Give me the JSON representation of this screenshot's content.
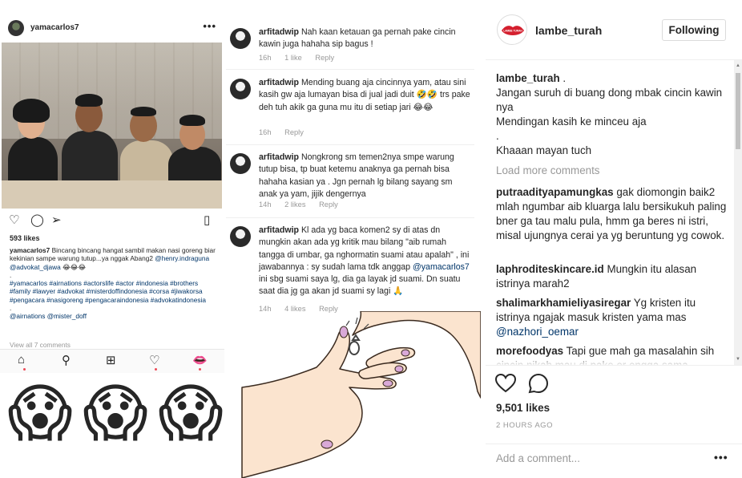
{
  "left_post": {
    "username": "yamacarlos7",
    "more": "•••",
    "likes": "593 likes",
    "caption_user": "yamacarlos7",
    "caption_text": "Bincang bincang hangat sambil makan nasi goreng biar kekinian sampe warung tutup...ya nggak Abang2",
    "caption_mentions": "@henry.indraguna @advokat_djawa",
    "caption_emoji": "😂😂😂",
    "dot1": ".",
    "hashtags": "#yamacarlos #airnations #actorslife #actor #indonesia #brothers #family #lawyer #advokat #misterdoffindonesia #corsa #jiwakorsa #pengacara #nasigoreng #pengacaraindonesia #advokatindonesia",
    "dot2": ".",
    "mentions2": "@airnations @mister_doff",
    "view_all": "View all 7 comments",
    "emojis": [
      "😱",
      "😱",
      "😱"
    ]
  },
  "middle_comments": [
    {
      "user": "arfitadwip",
      "text": "Nah kaan ketauan ga pernah pake cincin kawin juga hahaha sip bagus !",
      "time": "16h",
      "likes": "1 like",
      "reply": "Reply"
    },
    {
      "user": "arfitadwip",
      "text": "Mending buang aja cincinnya yam, atau sini kasih gw aja lumayan bisa di jual jadi duit 🤣🤣 trs pake deh tuh akik ga guna mu itu di setiap jari 😂😂",
      "time": "16h",
      "likes": "",
      "reply": "Reply"
    },
    {
      "user": "arfitadwip",
      "text": "Nongkrong sm temen2nya smpe warung tutup bisa, tp buat ketemu anaknya ga pernah bisa hahaha kasian ya . Jgn pernah lg bilang sayang sm anak ya yam, jijik dengernya",
      "time": "14h",
      "likes": "2 likes",
      "reply": "Reply"
    },
    {
      "user": "arfitadwip",
      "text_pre": "Kl ada yg baca komen2 sy di atas dn mungkin akan ada yg kritik mau bilang \"aib rumah tangga di umbar, ga nghormatin suami atau apalah\" ,  ini jawabannya : sy sudah lama tdk anggap ",
      "mention": "@yamacarlos7",
      "text_post": " ini sbg suami saya lg, dia ga layak jd suami. Dn suatu saat dia jg ga akan jd suami sy lagi 🙏",
      "time": "14h",
      "likes": "4 likes",
      "reply": "Reply"
    }
  ],
  "right_panel": {
    "account": "lambe_turah",
    "logo_text": "LAMBE TURAH",
    "follow_label": "Following",
    "caption_user": "lambe_turah",
    "caption_line0": ".",
    "caption_line1": "Jangan suruh di buang dong mbak cincin kawin nya",
    "caption_line2": "Mendingan kasih ke minceu aja",
    "caption_line3": ".",
    "caption_line4": "Khaaan mayan tuch",
    "load_more": "Load more comments",
    "comments": [
      {
        "user": "putraadityapamungkas",
        "text": "gak diomongin baik2 mlah ngumbar aib kluarga lalu bersikukuh paling bner ga tau malu pula, hmm ga beres ni istri, misal ujungnya cerai ya yg beruntung yg cowok."
      },
      {
        "user": "laphroditeskincare.id",
        "text": "Mungkin itu alasan istrinya marah2"
      },
      {
        "user": "shalimarkhamieliyasiregar",
        "text": "Yg kristen itu istrinya ngajak masuk kristen yama mas",
        "mention": "@nazhori_oemar"
      },
      {
        "user": "morefoodyas",
        "text": "Tapi gue mah ga masalahin sih cincin nikah mau di pake or engga sama"
      }
    ],
    "likes": "9,501 likes",
    "time_ago": "2 HOURS AGO",
    "add_comment_placeholder": "Add a comment...",
    "more": "•••"
  }
}
